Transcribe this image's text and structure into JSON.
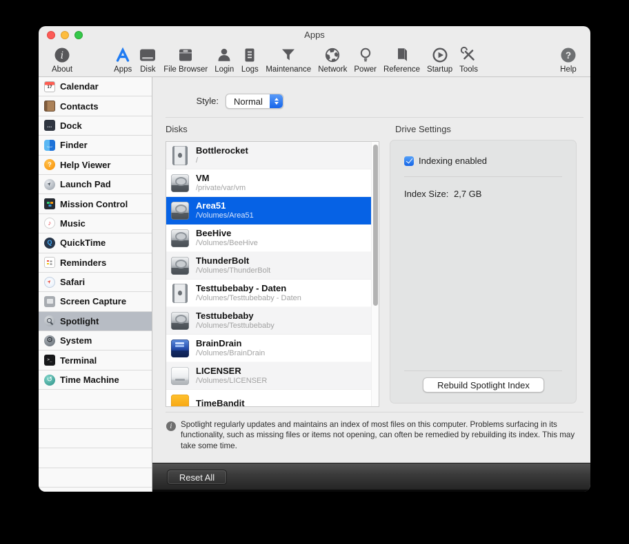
{
  "window": {
    "title": "Apps"
  },
  "toolbar": {
    "selected": "Apps",
    "items": [
      {
        "label": "About",
        "icon": "info-circle"
      },
      {
        "label": "Apps",
        "icon": "app-store-a",
        "selected": true
      },
      {
        "label": "Disk",
        "icon": "disk-drive"
      },
      {
        "label": "File Browser",
        "icon": "storage-box"
      },
      {
        "label": "Login",
        "icon": "person"
      },
      {
        "label": "Logs",
        "icon": "document-lines"
      },
      {
        "label": "Maintenance",
        "icon": "funnel"
      },
      {
        "label": "Network",
        "icon": "globe"
      },
      {
        "label": "Power",
        "icon": "lightbulb"
      },
      {
        "label": "Reference",
        "icon": "book"
      },
      {
        "label": "Startup",
        "icon": "play-circle"
      },
      {
        "label": "Tools",
        "icon": "crossed-tools"
      },
      {
        "label": "Help",
        "icon": "question-circle"
      }
    ]
  },
  "sidebar": {
    "items": [
      {
        "label": "Calendar",
        "icon": "calendar"
      },
      {
        "label": "Contacts",
        "icon": "contacts"
      },
      {
        "label": "Dock",
        "icon": "dock"
      },
      {
        "label": "Finder",
        "icon": "finder"
      },
      {
        "label": "Help Viewer",
        "icon": "helpviewer"
      },
      {
        "label": "Launch Pad",
        "icon": "launchpad"
      },
      {
        "label": "Mission Control",
        "icon": "missioncontrol"
      },
      {
        "label": "Music",
        "icon": "music"
      },
      {
        "label": "QuickTime",
        "icon": "quicktime"
      },
      {
        "label": "Reminders",
        "icon": "reminders"
      },
      {
        "label": "Safari",
        "icon": "safari"
      },
      {
        "label": "Screen Capture",
        "icon": "screencapture"
      },
      {
        "label": "Spotlight",
        "icon": "spotlight",
        "selected": true
      },
      {
        "label": "System",
        "icon": "system"
      },
      {
        "label": "Terminal",
        "icon": "terminal"
      },
      {
        "label": "Time Machine",
        "icon": "timemachine"
      }
    ]
  },
  "main": {
    "style_label": "Style:",
    "style_value": "Normal",
    "disks_label": "Disks",
    "disks": [
      {
        "name": "Bottlerocket",
        "path": "/",
        "icon": "tower"
      },
      {
        "name": "VM",
        "path": "/private/var/vm",
        "icon": "hdd"
      },
      {
        "name": "Area51",
        "path": "/Volumes/Area51",
        "icon": "hdd",
        "selected": true
      },
      {
        "name": "BeeHive",
        "path": "/Volumes/BeeHive",
        "icon": "hdd"
      },
      {
        "name": "ThunderBolt",
        "path": "/Volumes/ThunderBolt",
        "icon": "hdd"
      },
      {
        "name": "Testtubebaby - Daten",
        "path": "/Volumes/Testtubebaby - Daten",
        "icon": "tower"
      },
      {
        "name": "Testtubebaby",
        "path": "/Volumes/Testtubebaby",
        "icon": "hdd"
      },
      {
        "name": "BrainDrain",
        "path": "/Volumes/BrainDrain",
        "icon": "hdd-blue"
      },
      {
        "name": "LICENSER",
        "path": "/Volumes/LICENSER",
        "icon": "hdd-white"
      },
      {
        "name": "TimeBandit",
        "path": "",
        "icon": "orange"
      }
    ],
    "drive_settings": {
      "title": "Drive Settings",
      "indexing_label": "Indexing enabled",
      "indexing_checked": true,
      "index_size_label": "Index Size:",
      "index_size_value": "2,7 GB",
      "rebuild_button": "Rebuild Spotlight Index"
    },
    "footer_note": "Spotlight regularly updates and maintains an index of most files on this computer. Problems surfacing in its functionality, such as missing files or items not opening, can often be remedied by rebuilding its index. This may take some time."
  },
  "bottom_bar": {
    "reset_button": "Reset All"
  },
  "colors": {
    "selection_blue": "#0662e5",
    "checkbox_blue": "#1565e7",
    "sidebar_selected": "#b7bcc4",
    "window_background": "#ececec",
    "dark_bar": "#2e2e2e"
  }
}
